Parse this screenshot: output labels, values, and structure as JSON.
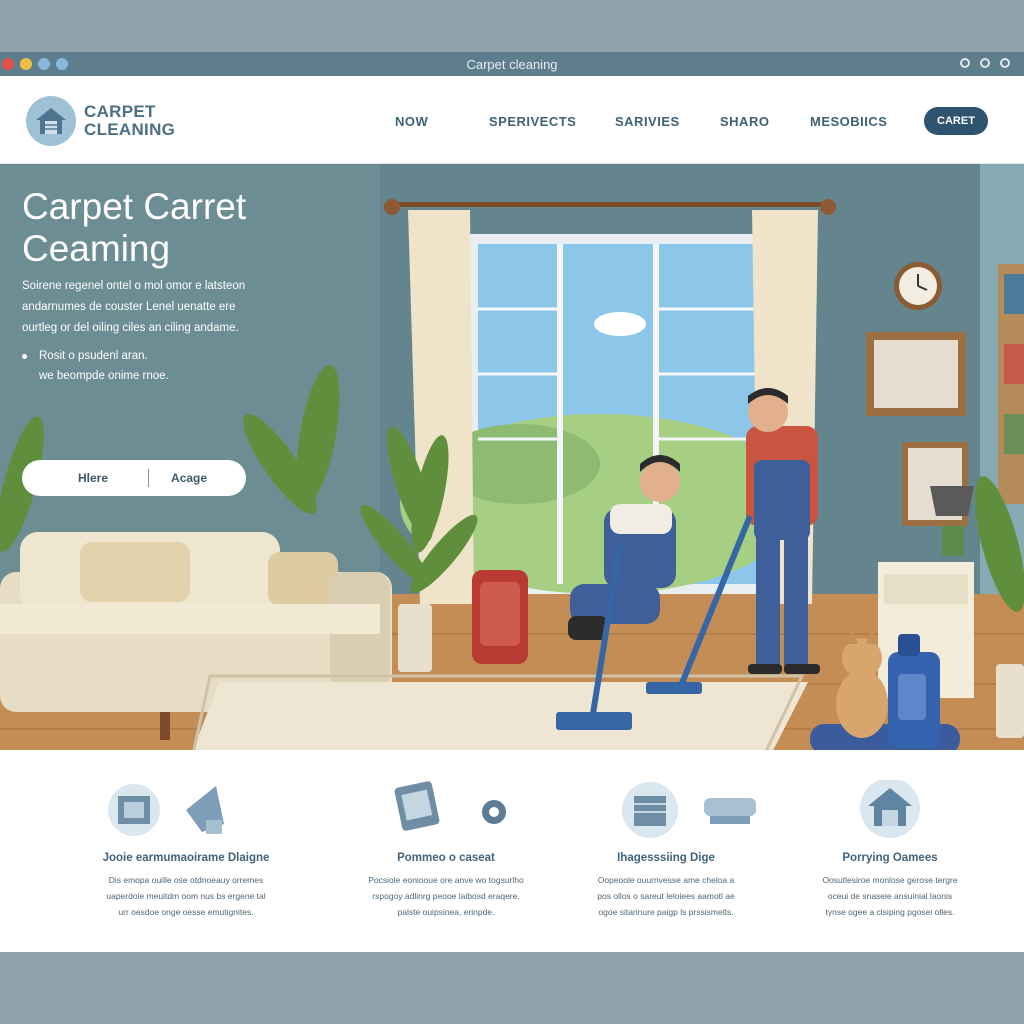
{
  "window": {
    "title": "Carpet cleaning"
  },
  "header": {
    "logo_line1": "CARPET",
    "logo_line2": "CLEANING",
    "nav": [
      "NOW",
      "SPERIVECTS",
      "SARIVIES",
      "SHARO",
      "MESOBIICS"
    ],
    "cta": "CARET"
  },
  "hero": {
    "title_line1": "Carpet Carret",
    "title_line2": "Ceaming",
    "desc_line1": "Soirene regenel ontel o mol omor e latsteon",
    "desc_line2": "andarnumes de couster Lenel uenatte ere",
    "desc_line3": "ourtleg or del oiling ciles an ciling andame.",
    "list_item1": "Rosit o psudenl aran.",
    "list_item2": "we beompde onime rnoe.",
    "button_here": "Hlere",
    "button_acage": "Acage"
  },
  "features": [
    {
      "title": "Jooie earmumaoirame Dlaigne",
      "desc": [
        "Dis emopa ouille ose otdnoeauy orremes",
        "uaperdoie meuitdm oom nus bs ergene tal",
        "urr oesdoe onge oesse emutignites."
      ]
    },
    {
      "title": "Pommeo o caseat",
      "desc": [
        "Pocsiole eoniooue ore anve wo togsurlho",
        "rspogoy adlinrg peooe laibosd eraqere.",
        "palste ouipsinea, erinpde."
      ]
    },
    {
      "title": "Ihagesssiing Dige",
      "desc": [
        "Oopeoole ouurnvesse ame cheloa a",
        "pos ollos o sareut leloiees aamotl ae",
        "ogoe sitarinure paigp ls prssismetls."
      ]
    },
    {
      "title": "Porrying Oamees",
      "desc": [
        "Oosutlesiroe monlose gerose tergre",
        "oceui de snaseie ansuinial laonis",
        "tynse ogee a clsiping pgosei olles."
      ]
    }
  ],
  "colors": {
    "accent": "#2f5470",
    "wall": "#6f8f96",
    "floor": "#c9955e",
    "header_text": "#3e6276"
  }
}
